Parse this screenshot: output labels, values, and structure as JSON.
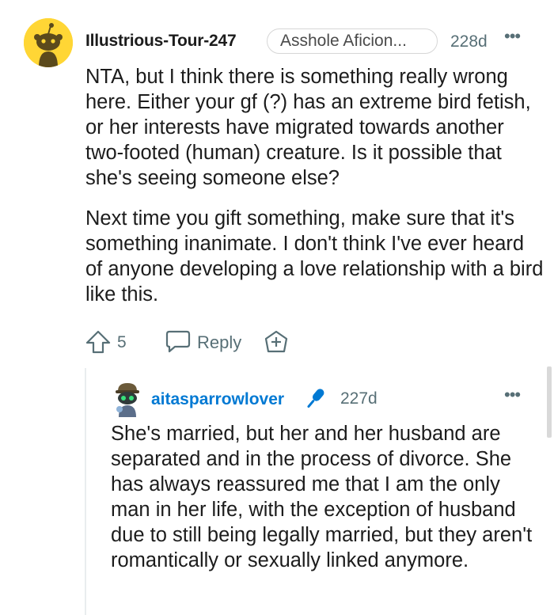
{
  "comment": {
    "username": "Illustrious-Tour-247",
    "flair": "Asshole Aficion...",
    "age": "228d",
    "more": "•••",
    "paragraphs": [
      "NTA, but I think there is something really wrong here. Either your gf (?) has an extreme bird fetish, or her interests have migrated towards another two-footed (human) creature. Is it possible that she's seeing someone else?",
      "Next time you gift something, make sure that it's something inanimate. I don't think I've ever heard of anyone developing a love relationship with a bird like this."
    ],
    "vote_count": "5",
    "reply_label": "Reply",
    "colors": {
      "avatar_bg": "#ffd635",
      "meta": "#576f76"
    }
  },
  "reply": {
    "username": "aitasparrowlover",
    "age": "227d",
    "more": "•••",
    "text": "She's married, but her and her husband are separated and in the process of divorce. She has always reassured me that I am the only man in her life, with the exception of husband due to still being legally married, but they aren't romantically or sexually linked anymore.",
    "colors": {
      "username": "#0079d3",
      "mic": "#0079d3"
    }
  },
  "icons": {
    "avatar1": "snoo-avatar-icon",
    "avatar2": "custom-snoo-avatar-icon",
    "upvote": "upvote-arrow-icon",
    "reply": "speech-bubble-icon",
    "award": "award-plus-icon",
    "mic": "microphone-icon"
  }
}
